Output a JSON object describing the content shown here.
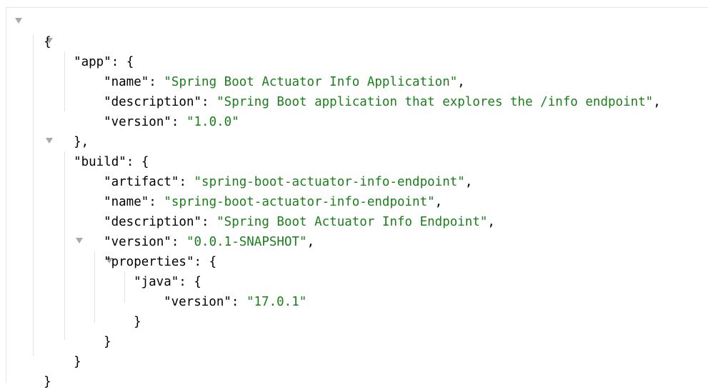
{
  "json_viewer": {
    "root_open": "{",
    "root_close": "}",
    "app": {
      "key": "\"app\"",
      "open": ": {",
      "close": "},",
      "name_key": "\"name\"",
      "name_value": "\"Spring Boot Actuator Info Application\"",
      "description_key": "\"description\"",
      "description_value": "\"Spring Boot application that explores the /info endpoint\"",
      "version_key": "\"version\"",
      "version_value": "\"1.0.0\""
    },
    "build": {
      "key": "\"build\"",
      "open": ": {",
      "close": "}",
      "artifact_key": "\"artifact\"",
      "artifact_value": "\"spring-boot-actuator-info-endpoint\"",
      "name_key": "\"name\"",
      "name_value": "\"spring-boot-actuator-info-endpoint\"",
      "description_key": "\"description\"",
      "description_value": "\"Spring Boot Actuator Info Endpoint\"",
      "version_key": "\"version\"",
      "version_value": "\"0.0.1-SNAPSHOT\"",
      "properties": {
        "key": "\"properties\"",
        "open": ": {",
        "close": "}",
        "java": {
          "key": "\"java\"",
          "open": ": {",
          "close": "}",
          "version_key": "\"version\"",
          "version_value": "\"17.0.1\""
        }
      }
    },
    "separator": ": ",
    "comma": ","
  }
}
